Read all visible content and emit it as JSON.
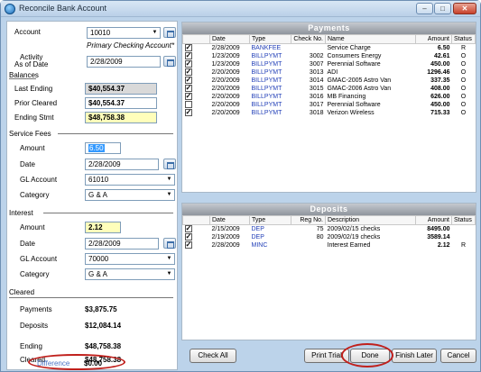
{
  "window": {
    "title": "Reconcile Bank Account",
    "min": "–",
    "max": "□",
    "close": "✕"
  },
  "account": {
    "label": "Account",
    "value": "10010",
    "name": "Primary Checking Account*"
  },
  "activity": {
    "label_line1": "Activity",
    "label_line2": "As of Date",
    "value": "2/28/2009"
  },
  "balances": {
    "header": "Balances",
    "last_ending_label": "Last Ending",
    "last_ending": "$40,554.37",
    "prior_cleared_label": "Prior Cleared",
    "prior_cleared": "$40,554.37",
    "ending_stmt_label": "Ending Stmt",
    "ending_stmt": "$48,758.38"
  },
  "service_fees": {
    "header": "Service Fees",
    "amount_label": "Amount",
    "amount": "6.50",
    "date_label": "Date",
    "date": "2/28/2009",
    "gl_label": "GL Account",
    "gl": "61010",
    "category_label": "Category",
    "category": "G & A"
  },
  "interest": {
    "header": "Interest",
    "amount_label": "Amount",
    "amount": "2.12",
    "date_label": "Date",
    "date": "2/28/2009",
    "gl_label": "GL Account",
    "gl": "70000",
    "category_label": "Category",
    "category": "G & A"
  },
  "cleared": {
    "header": "Cleared",
    "payments_label": "Payments",
    "payments": "$3,875.75",
    "deposits_label": "Deposits",
    "deposits": "$12,084.14",
    "ending_label": "Ending",
    "ending": "$48,758.38",
    "cleared_label": "Cleared",
    "cleared": "$48,758.38",
    "difference_label": "Difference",
    "difference": "$0.00"
  },
  "payments": {
    "title": "Payments",
    "columns": [
      "Date",
      "Type",
      "Check No.",
      "Name",
      "Amount",
      "Status"
    ],
    "rows": [
      {
        "checked": true,
        "date": "2/28/2009",
        "type": "BANKFEE",
        "check": "",
        "name": "Service Charge",
        "amount": "6.50",
        "status": "R"
      },
      {
        "checked": true,
        "date": "1/23/2009",
        "type": "BILLPYMT",
        "check": "3002",
        "name": "Consumers Energy",
        "amount": "42.61",
        "status": "O"
      },
      {
        "checked": true,
        "date": "1/23/2009",
        "type": "BILLPYMT",
        "check": "3007",
        "name": "Perennial Software",
        "amount": "450.00",
        "status": "O"
      },
      {
        "checked": true,
        "date": "2/20/2009",
        "type": "BILLPYMT",
        "check": "3013",
        "name": "ADI",
        "amount": "1296.46",
        "status": "O"
      },
      {
        "checked": true,
        "date": "2/20/2009",
        "type": "BILLPYMT",
        "check": "3014",
        "name": "GMAC-2005 Astro Van",
        "amount": "337.35",
        "status": "O"
      },
      {
        "checked": true,
        "date": "2/20/2009",
        "type": "BILLPYMT",
        "check": "3015",
        "name": "GMAC-2006 Astro Van",
        "amount": "408.00",
        "status": "O"
      },
      {
        "checked": true,
        "date": "2/20/2009",
        "type": "BILLPYMT",
        "check": "3016",
        "name": "MB Financing",
        "amount": "626.00",
        "status": "O"
      },
      {
        "checked": false,
        "date": "2/20/2009",
        "type": "BILLPYMT",
        "check": "3017",
        "name": "Perennial Software",
        "amount": "450.00",
        "status": "O"
      },
      {
        "checked": true,
        "date": "2/20/2009",
        "type": "BILLPYMT",
        "check": "3018",
        "name": "Verizon Wireless",
        "amount": "715.33",
        "status": "O"
      }
    ]
  },
  "deposits": {
    "title": "Deposits",
    "columns": [
      "Date",
      "Type",
      "Reg No.",
      "Description",
      "Amount",
      "Status"
    ],
    "rows": [
      {
        "checked": true,
        "date": "2/15/2009",
        "type": "DEP",
        "reg": "75",
        "desc": "2009/02/15 checks",
        "amount": "8495.00",
        "status": ""
      },
      {
        "checked": true,
        "date": "2/19/2009",
        "type": "DEP",
        "reg": "80",
        "desc": "2009/02/19 checks",
        "amount": "3589.14",
        "status": ""
      },
      {
        "checked": true,
        "date": "2/28/2009",
        "type": "MINC",
        "reg": "",
        "desc": "Interest Earned",
        "amount": "2.12",
        "status": "R"
      }
    ]
  },
  "buttons": {
    "check_all": "Check All",
    "print_trial": "Print Trial",
    "done": "Done",
    "finish_later": "Finish Later",
    "cancel": "Cancel"
  }
}
